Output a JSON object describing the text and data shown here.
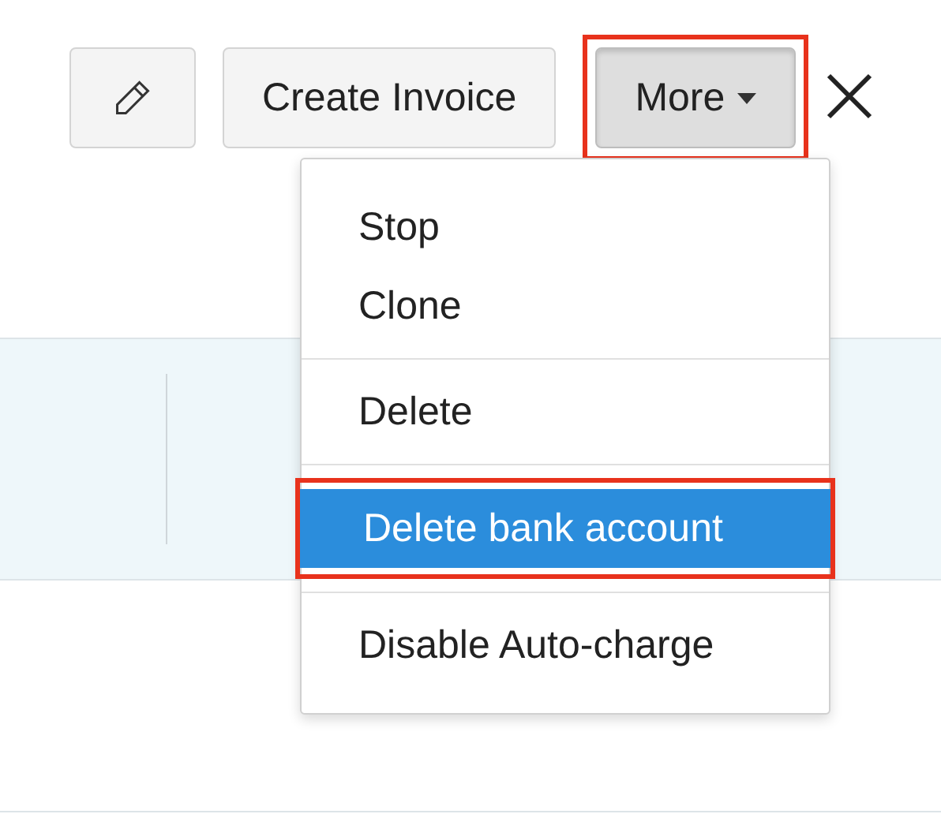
{
  "toolbar": {
    "buttons": [
      {
        "kind": "edit"
      },
      {
        "kind": "text",
        "label": "Create Invoice",
        "pressed": false,
        "highlighted": false
      },
      {
        "kind": "dropdown",
        "label": "More",
        "pressed": true,
        "highlighted": true
      },
      {
        "kind": "close"
      }
    ]
  },
  "menu": {
    "groups": [
      {
        "items": [
          {
            "label": "Stop",
            "selected": false,
            "highlighted": false
          },
          {
            "label": "Clone",
            "selected": false,
            "highlighted": false
          }
        ]
      },
      {
        "items": [
          {
            "label": "Delete",
            "selected": false,
            "highlighted": false
          }
        ]
      },
      {
        "items": [
          {
            "label": "Delete bank account",
            "selected": true,
            "highlighted": true
          }
        ]
      },
      {
        "items": [
          {
            "label": "Disable Auto-charge",
            "selected": false,
            "highlighted": false
          }
        ]
      }
    ]
  }
}
